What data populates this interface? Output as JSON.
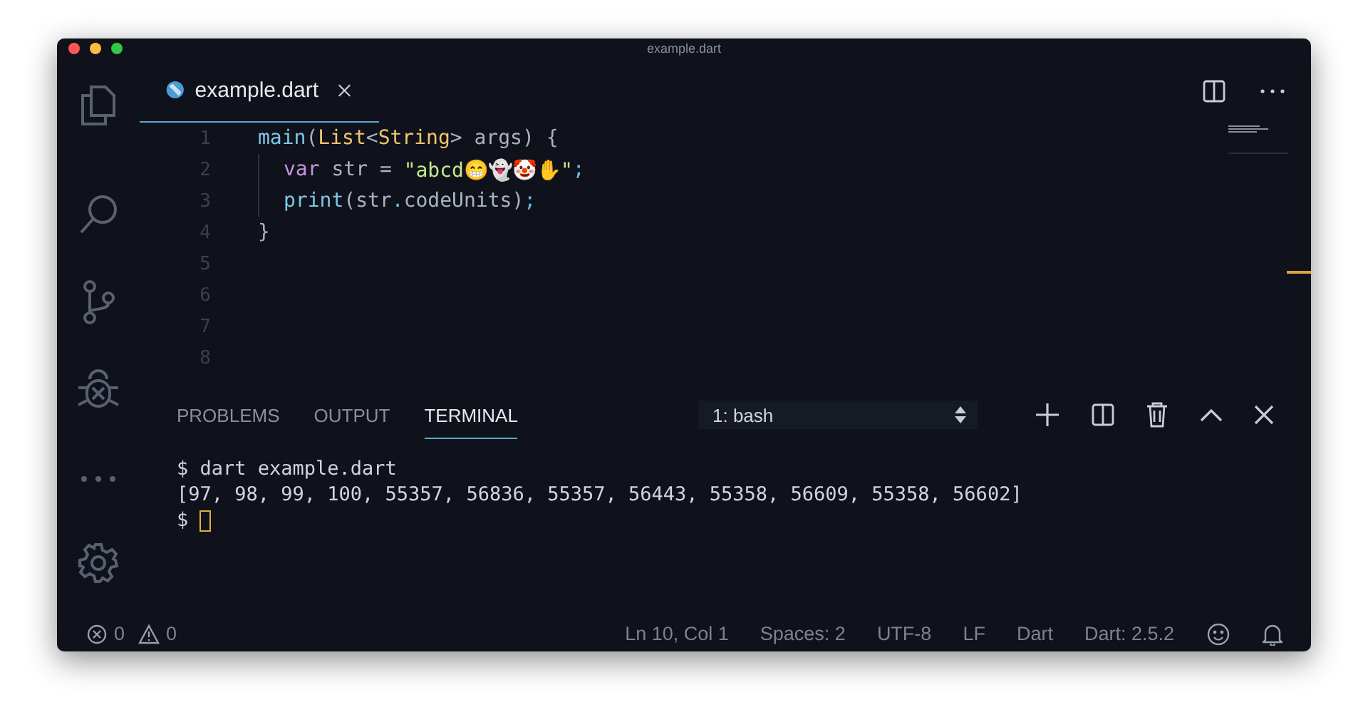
{
  "window": {
    "title": "example.dart"
  },
  "activity_bar": [
    {
      "kind": "files",
      "selected": false
    },
    {
      "kind": "search",
      "selected": false
    },
    {
      "kind": "source-control",
      "selected": false
    },
    {
      "kind": "debug",
      "selected": false
    },
    {
      "kind": "more",
      "selected": false
    }
  ],
  "editor": {
    "tabs": [
      {
        "label": "example.dart",
        "selected": true
      }
    ],
    "lines": [
      {
        "number": "1",
        "tokens": [
          {
            "kind": "fn",
            "text": "main"
          },
          {
            "kind": "punc",
            "text": "("
          },
          {
            "kind": "type",
            "text": "List"
          },
          {
            "kind": "punc",
            "text": "<"
          },
          {
            "kind": "type",
            "text": "String"
          },
          {
            "kind": "punc",
            "text": ">"
          },
          {
            "kind": "plain",
            "text": " args"
          },
          {
            "kind": "punc",
            "text": ") {"
          }
        ]
      },
      {
        "number": "2",
        "indented": true,
        "tokens": [
          {
            "kind": "keyword",
            "text": "var"
          },
          {
            "kind": "plain",
            "text": " str "
          },
          {
            "kind": "punc",
            "text": "="
          },
          {
            "kind": "string",
            "text": " \"abcd😁👻🤡✋\""
          },
          {
            "kind": "semi",
            "text": ";"
          }
        ]
      },
      {
        "number": "3",
        "indented": true,
        "tokens": [
          {
            "kind": "fn",
            "text": "print"
          },
          {
            "kind": "punc",
            "text": "("
          },
          {
            "kind": "plain",
            "text": "str"
          },
          {
            "kind": "semi",
            "text": "."
          },
          {
            "kind": "plain",
            "text": "codeUnits"
          },
          {
            "kind": "punc",
            "text": ")"
          },
          {
            "kind": "semi",
            "text": ";"
          }
        ]
      },
      {
        "number": "4",
        "tokens": [
          {
            "kind": "punc",
            "text": "}"
          }
        ]
      },
      {
        "number": "5"
      },
      {
        "number": "6"
      },
      {
        "number": "7"
      },
      {
        "number": "8"
      }
    ]
  },
  "panel": {
    "tabs": [
      {
        "label": "PROBLEMS",
        "selected": false
      },
      {
        "label": "OUTPUT",
        "selected": false
      },
      {
        "label": "TERMINAL",
        "selected": true
      }
    ],
    "terminal_select": "1: bash",
    "terminal_lines": [
      "$ dart example.dart",
      "[97, 98, 99, 100, 55357, 56836, 55357, 56443, 55358, 56609, 55358, 56602]",
      "$ "
    ]
  },
  "status_bar": {
    "errors": "0",
    "warnings": "0",
    "items": [
      "Ln 10, Col 1",
      "Spaces: 2",
      "UTF-8",
      "LF",
      "Dart",
      "Dart: 2.5.2"
    ]
  }
}
